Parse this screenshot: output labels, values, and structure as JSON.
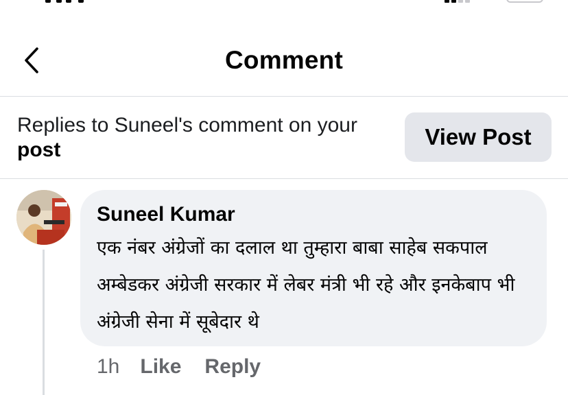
{
  "header": {
    "title": "Comment"
  },
  "context": {
    "text_prefix": "Replies to Suneel's comment on your ",
    "post_word": "post",
    "view_post_label": "View Post"
  },
  "comment": {
    "author": "Suneel Kumar",
    "text": "एक नंबर अंग्रेजों का दलाल था तुम्हारा बाबा साहेब सकपाल अम्बेडकर अंग्रेजी सरकार में लेबर मंत्री भी रहे और इनकेबाप भी अंग्रेजी सेना में सूबेदार थे",
    "time": "1h",
    "like_label": "Like",
    "reply_label": "Reply"
  },
  "colors": {
    "bubble": "#f0f2f5",
    "button": "#e4e6eb",
    "secondary_text": "#65676b",
    "battery": "#34c759"
  },
  "icons": {
    "back": "chevron-left-icon",
    "battery": "battery-icon",
    "signal": "signal-icon"
  }
}
